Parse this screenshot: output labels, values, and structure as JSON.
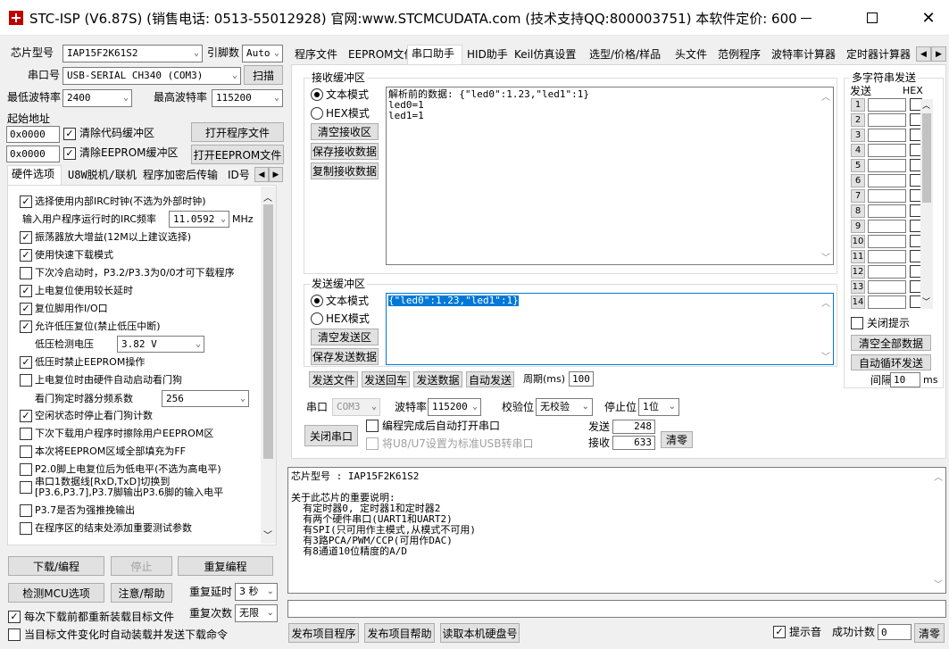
{
  "window": {
    "title": "STC-ISP (V6.87S) (销售电话: 0513-55012928) 官网:www.STCMCUDATA.com  (技术支持QQ:800003751) 本软件定价: 600..."
  },
  "left": {
    "chip_label": "芯片型号",
    "chip_value": "IAP15F2K61S2",
    "pins_label": "引脚数",
    "pins_value": "Auto",
    "port_label": "串口号",
    "port_value": "USB-SERIAL CH340 (COM3)",
    "scan_btn": "扫描",
    "min_baud_label": "最低波特率",
    "min_baud_value": "2400",
    "max_baud_label": "最高波特率",
    "max_baud_value": "115200",
    "start_addr_label": "起始地址",
    "addr1": "0x0000",
    "clear_code": "清除代码缓冲区",
    "open_prog": "打开程序文件",
    "addr2": "0x0000",
    "clear_eeprom": "清除EEPROM缓冲区",
    "open_eeprom": "打开EEPROM文件",
    "tabs": [
      "硬件选项",
      "U8W脱机/联机",
      "程序加密后传输",
      "ID号"
    ],
    "opts": [
      {
        "text": "选择使用内部IRC时钟(不选为外部时钟)",
        "checked": "✓"
      },
      {
        "text": "振荡器放大增益(12M以上建议选择)",
        "checked": "✓"
      },
      {
        "text": "使用快速下载模式",
        "checked": "✓"
      },
      {
        "text": "下次冷启动时，P3.2/P3.3为0/0才可下载程序",
        "checked": ""
      },
      {
        "text": "上电复位使用较长延时",
        "checked": "✓"
      },
      {
        "text": "复位脚用作I/O口",
        "checked": "✓"
      },
      {
        "text": "允许低压复位(禁止低压中断)",
        "checked": "✓"
      },
      {
        "text": "低压时禁止EEPROM操作",
        "checked": "✓"
      },
      {
        "text": "上电复位时由硬件自动启动看门狗",
        "checked": ""
      },
      {
        "text": "空闲状态时停止看门狗计数",
        "checked": "✓"
      },
      {
        "text": "下次下载用户程序时擦除用户EEPROM区",
        "checked": ""
      },
      {
        "text": "本次将EEPROM区域全部填充为FF",
        "checked": ""
      },
      {
        "text": "P2.0脚上电复位后为低电平(不选为高电平)",
        "checked": ""
      },
      {
        "text": "串口1数据线[RxD,TxD]切换到",
        "checked": ""
      },
      {
        "text": "[P3.6,P3.7],P3.7脚输出P3.6脚的输入电平",
        "checked": ""
      },
      {
        "text": "P3.7是否为强推挽输出",
        "checked": ""
      },
      {
        "text": "在程序区的结束处添加重要测试参数",
        "checked": ""
      }
    ],
    "irc_label": "输入用户程序运行时的IRC频率",
    "irc_value": "11.0592",
    "irc_unit": "MHz",
    "lv_label": "低压检测电压",
    "lv_value": "3.82 V",
    "wdt_label": "看门狗定时器分频系数",
    "wdt_value": "256",
    "download_btn": "下载/编程",
    "stop_btn": "停止",
    "reprog_btn": "重复编程",
    "detect_btn": "检测MCU选项",
    "notice_btn": "注意/帮助",
    "delay_label": "重复延时",
    "delay_value": "3 秒",
    "reload_check": "每次下载前都重新装载目标文件",
    "count_label": "重复次数",
    "count_value": "无限",
    "auto_check": "当目标文件变化时自动装载并发送下载命令"
  },
  "right": {
    "tabs": [
      "程序文件",
      "EEPROM文件",
      "串口助手",
      "HID助手",
      "Keil仿真设置",
      "选型/价格/样品",
      "头文件",
      "范例程序",
      "波特率计算器",
      "定时器计算器"
    ],
    "recv_title": "接收缓冲区",
    "text_mode": "文本模式",
    "hex_mode": "HEX模式",
    "clear_recv": "清空接收区",
    "save_recv": "保存接收数据",
    "copy_recv": "复制接收数据",
    "recv_lines": [
      "解析前的数据: {\"led0\":1.23,\"led1\":1}",
      "led0=1",
      "led1=1"
    ],
    "send_title": "发送缓冲区",
    "send_text": "{\"led0\":1.23,\"led1\":1}",
    "clear_send": "清空发送区",
    "save_send": "保存发送数据",
    "send_file": "发送文件",
    "send_cr": "发送回车",
    "send_data": "发送数据",
    "auto_send": "自动发送",
    "period_label": "周期(ms)",
    "period_value": "100",
    "multi_title": "多字符串发送",
    "col_send": "发送",
    "col_hex": "HEX",
    "multi_rows": [
      "1",
      "2",
      "3",
      "4",
      "5",
      "6",
      "7",
      "8",
      "9",
      "10",
      "11",
      "12",
      "13",
      "14"
    ],
    "close_hint": "关闭提示",
    "clear_all": "清空全部数据",
    "auto_loop": "自动循环发送",
    "interval_label": "间隔",
    "interval_value": "10",
    "interval_unit": "ms",
    "serial_label": "串口",
    "serial_value": "COM3",
    "baud_label": "波特率",
    "baud_value": "115200",
    "parity_label": "校验位",
    "parity_value": "无校验",
    "stop_label": "停止位",
    "stop_value": "1位",
    "close_port": "关闭串口",
    "auto_open": "编程完成后自动打开串口",
    "usb_check": "将U8/U7设置为标准USB转串口",
    "sent_label": "发送",
    "sent_value": "248",
    "recv_label": "接收",
    "recv_value": "633",
    "clear_count": "清零",
    "info_lines": [
      "芯片型号 : IAP15F2K61S2",
      "",
      "关于此芯片的重要说明:",
      "  有定时器0, 定时器1和定时器2",
      "  有两个硬件串口(UART1和UART2)",
      "  有SPI(只可用作主模式,从模式不可用)",
      "  有3路PCA/PWM/CCP(可用作DAC)",
      "  有8通道10位精度的A/D"
    ],
    "publish_prog": "发布项目程序",
    "publish_help": "发布项目帮助",
    "read_disk": "读取本机硬盘号",
    "hint_sound": "提示音",
    "success_label": "成功计数",
    "success_value": "0",
    "clear_btn": "清零"
  },
  "colors": {
    "accent": "#0078d7",
    "titlebar": "#ffffff",
    "bg": "#f0f0f0"
  }
}
